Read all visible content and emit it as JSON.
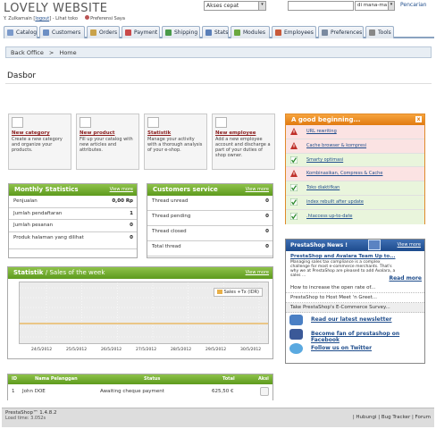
{
  "header": {
    "site_title": "LOVELY WEBSITE",
    "user_prefix": "Y. Zulkarnain",
    "logout": "logout",
    "view_shop": "Lihat toko",
    "preferences": "Preferensi Saya",
    "quick_access": "Akses cepat",
    "search_where": "di mana-ma",
    "search_button": "Pencarian"
  },
  "tabs": [
    {
      "label": "Catalog",
      "icon": "catalog-icon",
      "color": "#7b9acb"
    },
    {
      "label": "Customers",
      "icon": "customers-icon",
      "color": "#6c8fc4"
    },
    {
      "label": "Orders",
      "icon": "orders-icon",
      "color": "#c9a24a"
    },
    {
      "label": "Payment",
      "icon": "payment-icon",
      "color": "#c94a4a"
    },
    {
      "label": "Shipping",
      "icon": "shipping-icon",
      "color": "#4a9a4a"
    },
    {
      "label": "Stats",
      "icon": "stats-icon",
      "color": "#5a7fb8"
    },
    {
      "label": "Modules",
      "icon": "modules-icon",
      "color": "#6aa840"
    },
    {
      "label": "Employees",
      "icon": "employees-icon",
      "color": "#c85a3a"
    },
    {
      "label": "Preferences",
      "icon": "preferences-icon",
      "color": "#7a8aa0"
    },
    {
      "label": "Tools",
      "icon": "tools-icon",
      "color": "#888"
    }
  ],
  "breadcrumb": {
    "section": "Back Office",
    "separator": ">",
    "page": "Home"
  },
  "page_title": "Dasbor",
  "quick_actions": [
    {
      "title": "New category",
      "desc": "Create a new category and organize your products."
    },
    {
      "title": "New product",
      "desc": "Fill up your catalog with new articles and attributes."
    },
    {
      "title": "Statistik",
      "desc": "Manage your activity with a thorough analysis of your e-shop."
    },
    {
      "title": "New employee",
      "desc": "Add a new employee account and discharge a part of your duties of shop owner."
    }
  ],
  "monthly_stats": {
    "title": "Monthly Statistics",
    "view_more": "View more",
    "rows": [
      {
        "label": "Penjualan",
        "value": "0,00 Rp"
      },
      {
        "label": "Jumlah pendaftaran",
        "value": "1"
      },
      {
        "label": "Jumlah pesanan",
        "value": "0"
      },
      {
        "label": "Produk halaman yang dilihat",
        "value": "0"
      }
    ]
  },
  "customers_service": {
    "title": "Customers service",
    "view_more": "View more",
    "rows": [
      {
        "label": "Thread unread",
        "value": "0"
      },
      {
        "label": "Thread pending",
        "value": "0"
      },
      {
        "label": "Thread closed",
        "value": "0"
      },
      {
        "label": "Total thread",
        "value": "0"
      }
    ]
  },
  "good_beginning": {
    "title": "A good beginning...",
    "close": "x",
    "items": [
      {
        "label": "URL rewriting",
        "status": "warning"
      },
      {
        "label": "Cache browser & kompresi",
        "status": "warning"
      },
      {
        "label": "Smarty optimasi",
        "status": "ok"
      },
      {
        "label": "Kombinasikan, Compress & Cache",
        "status": "warning"
      },
      {
        "label": "Toko diaktifkan",
        "status": "ok"
      },
      {
        "label": "index rebuilt after update",
        "status": "ok"
      },
      {
        "label": ".htaccess up-to-date",
        "status": "ok"
      }
    ]
  },
  "news": {
    "title": "PrestaShop News !",
    "view_more": "View more",
    "headline": "PrestaShop and Avalara Team Up to...",
    "summary": "Managing sales tax compliance is a complex challenge for most e-commerce merchants. That's why we at PrestaShop are pleased to add Avalara, a sales ...",
    "read_more": "Read more",
    "links": [
      "How to increase the open rate of...",
      "PrestaShop to Host Meet 'n Greet...",
      "Take PrestaShop's E-Commerce Survey..."
    ],
    "social": [
      {
        "label": "Read our latest newsletter",
        "icon": "newsletter-icon",
        "color": "#4a7fc4"
      },
      {
        "label": "Become fan of prestashop on Facebook",
        "icon": "facebook-icon",
        "color": "#3b5998"
      },
      {
        "label": "Follow us on Twitter",
        "icon": "twitter-icon",
        "color": "#5aa9e0"
      }
    ]
  },
  "chart_data": {
    "type": "line",
    "title": "Statistik",
    "subtitle": "/ Sales of the week",
    "view_more": "View more",
    "series": [
      {
        "name": "Sales +Tx (IDR)",
        "values": [
          0,
          0,
          0,
          0,
          0,
          0,
          0,
          0
        ]
      }
    ],
    "x": [
      "24/5/2012",
      "25/5/2012",
      "26/5/2012",
      "27/5/2012",
      "28/5/2012",
      "29/5/2012",
      "30/5/2012"
    ],
    "color": "#e8b04a"
  },
  "orders": {
    "headers": {
      "id": "ID",
      "name": "Nama Pelanggan",
      "status": "Status",
      "total": "Total",
      "action": "Aksi"
    },
    "rows": [
      {
        "id": "1",
        "name": "John DOE",
        "status": "Awaiting cheque payment",
        "total": "625,50 €"
      }
    ]
  },
  "footer": {
    "version": "PrestaShop™ 1.4.8.2",
    "load": "Load time: 3.052s",
    "links": "| Hubungi | Bug Tracker | Forum"
  }
}
